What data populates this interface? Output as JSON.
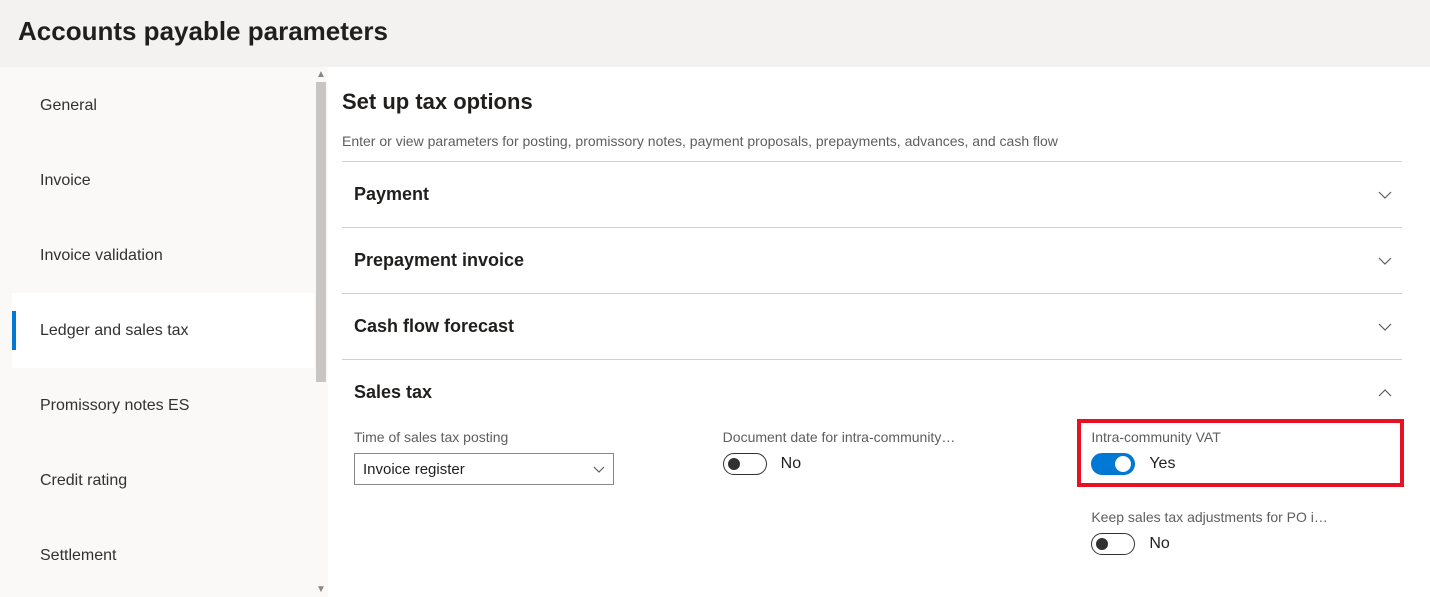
{
  "header": {
    "title": "Accounts payable parameters"
  },
  "sidebar": {
    "items": [
      {
        "label": "General"
      },
      {
        "label": "Invoice"
      },
      {
        "label": "Invoice validation"
      },
      {
        "label": "Ledger and sales tax"
      },
      {
        "label": "Promissory notes ES"
      },
      {
        "label": "Credit rating"
      },
      {
        "label": "Settlement"
      }
    ],
    "active_index": 3
  },
  "main": {
    "section_title": "Set up tax options",
    "section_desc": "Enter or view parameters for posting, promissory notes, payment proposals, prepayments, advances, and cash flow",
    "accordions": [
      {
        "label": "Payment",
        "expanded": false
      },
      {
        "label": "Prepayment invoice",
        "expanded": false
      },
      {
        "label": "Cash flow forecast",
        "expanded": false
      },
      {
        "label": "Sales tax",
        "expanded": true
      }
    ],
    "sales_tax": {
      "time_of_posting": {
        "label": "Time of sales tax posting",
        "value": "Invoice register"
      },
      "document_date": {
        "label": "Document date for intra-community…",
        "value": "No",
        "on": false
      },
      "intra_vat": {
        "label": "Intra-community VAT",
        "value": "Yes",
        "on": true
      },
      "keep_adjustments": {
        "label": "Keep sales tax adjustments for PO i…",
        "value": "No",
        "on": false
      }
    }
  }
}
